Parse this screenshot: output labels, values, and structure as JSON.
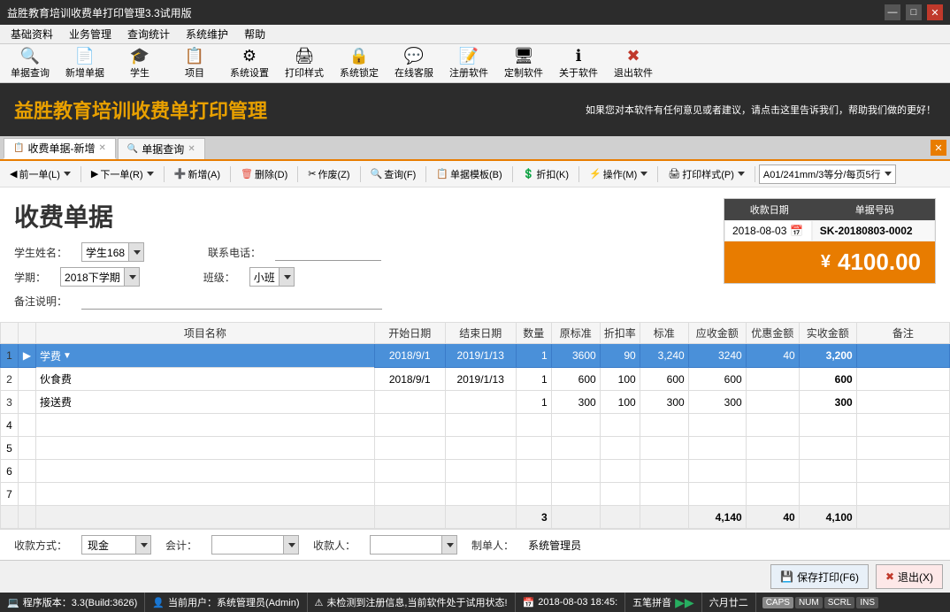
{
  "titlebar": {
    "title": "益胜教育培训收费单打印管理3.3试用版",
    "controls": [
      "—",
      "□",
      "✕"
    ]
  },
  "menubar": {
    "items": [
      "基础资料",
      "业务管理",
      "查询统计",
      "系统维护",
      "帮助"
    ]
  },
  "toolbar": {
    "buttons": [
      {
        "icon": "🔍",
        "label": "单据查询"
      },
      {
        "icon": "📄",
        "label": "新增单据"
      },
      {
        "icon": "🎓",
        "label": "学生"
      },
      {
        "icon": "📋",
        "label": "项目"
      },
      {
        "icon": "⚙",
        "label": "系统设置"
      },
      {
        "icon": "🖨",
        "label": "打印样式"
      },
      {
        "icon": "🔒",
        "label": "系统锁定"
      },
      {
        "icon": "💬",
        "label": "在线客服"
      },
      {
        "icon": "📝",
        "label": "注册软件"
      },
      {
        "icon": "🖥",
        "label": "定制软件"
      },
      {
        "icon": "ℹ",
        "label": "关于软件"
      },
      {
        "icon": "✖",
        "label": "退出软件"
      }
    ]
  },
  "app": {
    "title": "益胜教育培训收费单打印管理",
    "notice": "如果您对本软件有任何意见或者建议，请点击这里告诉我们，帮助我们做的更好！"
  },
  "tabs": [
    {
      "label": "收费单据-新增",
      "active": true
    },
    {
      "label": "单据查询",
      "active": false
    }
  ],
  "actionbar": {
    "buttons": [
      {
        "icon": "◀",
        "label": "前一单(L)"
      },
      {
        "icon": "▶",
        "label": "下一单(R)"
      },
      {
        "icon": "➕",
        "label": "新增(A)"
      },
      {
        "icon": "🗑",
        "label": "删除(D)"
      },
      {
        "icon": "✂",
        "label": "作废(Z)"
      },
      {
        "icon": "🔍",
        "label": "查询(F)"
      },
      {
        "icon": "📋",
        "label": "单据模板(B)"
      },
      {
        "icon": "💲",
        "label": "折扣(K)"
      },
      {
        "icon": "⚡",
        "label": "操作(M)"
      },
      {
        "icon": "🖨",
        "label": "打印样式(P)"
      }
    ],
    "style_selector": "A01/241mm/3等分/每页5行"
  },
  "form": {
    "title": "收费单据",
    "student_label": "学生姓名：",
    "student_value": "学生168",
    "phone_label": "联系电话：",
    "phone_value": "",
    "term_label": "学期：",
    "term_value": "2018下学期",
    "class_label": "班级：",
    "class_value": "小班",
    "remark_label": "备注说明：",
    "remark_value": ""
  },
  "receipt": {
    "date_label": "收款日期",
    "num_label": "单据号码",
    "date_value": "2018-08-03",
    "num_value": "SK-20180803-0002",
    "currency_symbol": "¥",
    "amount": "4100.00"
  },
  "table": {
    "headers": [
      "项目名称",
      "开始日期",
      "结束日期",
      "数量",
      "原标准",
      "折扣率",
      "标准",
      "应收金额",
      "优惠金额",
      "实收金额",
      "备注"
    ],
    "rows": [
      {
        "num": 1,
        "name": "学费",
        "start": "2018/9/1",
        "end": "2019/1/13",
        "qty": 1,
        "original": 3600,
        "discount": 90,
        "standard": "3,240",
        "receivable": 3240,
        "rebate": 40,
        "actual": "3,200",
        "note": "",
        "selected": true
      },
      {
        "num": 2,
        "name": "伙食费",
        "start": "2018/9/1",
        "end": "2019/1/13",
        "qty": 1,
        "original": 600,
        "discount": 100,
        "standard": 600,
        "receivable": 600,
        "rebate": "",
        "actual": "600",
        "note": ""
      },
      {
        "num": 3,
        "name": "接送费",
        "start": "",
        "end": "",
        "qty": 1,
        "original": 300,
        "discount": 100,
        "standard": 300,
        "receivable": 300,
        "rebate": "",
        "actual": "300",
        "note": ""
      },
      {
        "num": 4,
        "name": "",
        "start": "",
        "end": "",
        "qty": "",
        "original": "",
        "discount": "",
        "standard": "",
        "receivable": "",
        "rebate": "",
        "actual": "",
        "note": ""
      },
      {
        "num": 5,
        "name": "",
        "start": "",
        "end": "",
        "qty": "",
        "original": "",
        "discount": "",
        "standard": "",
        "receivable": "",
        "rebate": "",
        "actual": "",
        "note": ""
      },
      {
        "num": 6,
        "name": "",
        "start": "",
        "end": "",
        "qty": "",
        "original": "",
        "discount": "",
        "standard": "",
        "receivable": "",
        "rebate": "",
        "actual": "",
        "note": ""
      },
      {
        "num": 7,
        "name": "",
        "start": "",
        "end": "",
        "qty": "",
        "original": "",
        "discount": "",
        "standard": "",
        "receivable": "",
        "rebate": "",
        "actual": "",
        "note": ""
      }
    ],
    "totals": {
      "qty": 3,
      "receivable": "4,140",
      "rebate": 40,
      "actual": "4,100"
    }
  },
  "bottom_form": {
    "payment_label": "收款方式：",
    "payment_value": "现金",
    "accountant_label": "会计：",
    "accountant_value": "",
    "collector_label": "收款人：",
    "collector_value": "",
    "maker_label": "制单人：",
    "maker_value": "系统管理员"
  },
  "bottom_actions": {
    "save_print": "保存打印(F6)",
    "exit": "退出(X)"
  },
  "statusbar": {
    "version": "程序版本：3.3(Build:3626)",
    "user": "当前用户：系统管理员(Admin)",
    "notice": "未检测到注册信息,当前软件处于试用状态!",
    "datetime": "2018-08-03 18:45:",
    "ime": "五笔拼音",
    "date_cn": "六月廿二",
    "caps": "CAPS",
    "num": "NUM",
    "scrl": "SCRL",
    "ins": "INS"
  }
}
